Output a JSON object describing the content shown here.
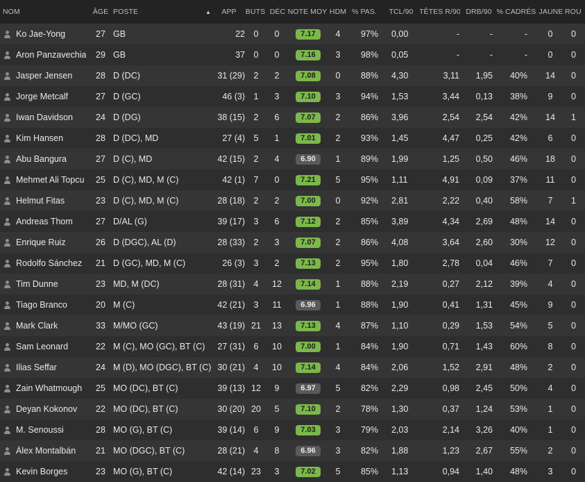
{
  "header": {
    "nom": "NOM",
    "age": "ÂGE",
    "poste": "POSTE",
    "app": "APP",
    "buts": "BUTS",
    "dec": "DÉC",
    "note": "NOTE MOY",
    "hdm": "HDM",
    "pas": "% PAS.",
    "tcl": "TCL/90",
    "tetes": "TÊTES R/90",
    "drb": "DRB/90",
    "cadres": "% CADRÉS",
    "jaune": "JAUNE",
    "rouge": "ROU"
  },
  "sort_indicator": "▲",
  "colors": {
    "good_rating": "#7bb84a",
    "neutral_rating": "#5a5a5a"
  },
  "players": [
    {
      "name": "Ko Jae-Yong",
      "age": "27",
      "pos": "GB",
      "app": "22",
      "buts": "0",
      "dec": "0",
      "note": "7.17",
      "good": true,
      "hdm": "4",
      "pas": "97%",
      "tcl": "0,00",
      "tetes": "-",
      "drb": "-",
      "cadres": "-",
      "jaune": "0",
      "rouge": "0"
    },
    {
      "name": "Aron Panzavechia",
      "age": "29",
      "pos": "GB",
      "app": "37",
      "buts": "0",
      "dec": "0",
      "note": "7.16",
      "good": true,
      "hdm": "3",
      "pas": "98%",
      "tcl": "0,05",
      "tetes": "-",
      "drb": "-",
      "cadres": "-",
      "jaune": "0",
      "rouge": "0"
    },
    {
      "name": "Jasper Jensen",
      "age": "28",
      "pos": "D (DC)",
      "app": "31 (29)",
      "buts": "2",
      "dec": "2",
      "note": "7.08",
      "good": true,
      "hdm": "0",
      "pas": "88%",
      "tcl": "4,30",
      "tetes": "3,11",
      "drb": "1,95",
      "cadres": "40%",
      "jaune": "14",
      "rouge": "0"
    },
    {
      "name": "Jorge Metcalf",
      "age": "27",
      "pos": "D (GC)",
      "app": "46 (3)",
      "buts": "1",
      "dec": "3",
      "note": "7.10",
      "good": true,
      "hdm": "3",
      "pas": "94%",
      "tcl": "1,53",
      "tetes": "3,44",
      "drb": "0,13",
      "cadres": "38%",
      "jaune": "9",
      "rouge": "0"
    },
    {
      "name": "Iwan Davidson",
      "age": "24",
      "pos": "D (DG)",
      "app": "38 (15)",
      "buts": "2",
      "dec": "6",
      "note": "7.07",
      "good": true,
      "hdm": "2",
      "pas": "86%",
      "tcl": "3,96",
      "tetes": "2,54",
      "drb": "2,54",
      "cadres": "42%",
      "jaune": "14",
      "rouge": "1"
    },
    {
      "name": "Kim Hansen",
      "age": "28",
      "pos": "D (DC), MD",
      "app": "27 (4)",
      "buts": "5",
      "dec": "1",
      "note": "7.01",
      "good": true,
      "hdm": "2",
      "pas": "93%",
      "tcl": "1,45",
      "tetes": "4,47",
      "drb": "0,25",
      "cadres": "42%",
      "jaune": "6",
      "rouge": "0"
    },
    {
      "name": "Abu Bangura",
      "age": "27",
      "pos": "D (C), MD",
      "app": "42 (15)",
      "buts": "2",
      "dec": "4",
      "note": "6.90",
      "good": false,
      "hdm": "1",
      "pas": "89%",
      "tcl": "1,99",
      "tetes": "1,25",
      "drb": "0,50",
      "cadres": "46%",
      "jaune": "18",
      "rouge": "0"
    },
    {
      "name": "Mehmet Ali Topcu",
      "age": "25",
      "pos": "D (C), MD, M (C)",
      "app": "42 (1)",
      "buts": "7",
      "dec": "0",
      "note": "7.21",
      "good": true,
      "hdm": "5",
      "pas": "95%",
      "tcl": "1,11",
      "tetes": "4,91",
      "drb": "0,09",
      "cadres": "37%",
      "jaune": "11",
      "rouge": "0"
    },
    {
      "name": "Helmut Fitas",
      "age": "23",
      "pos": "D (C), MD, M (C)",
      "app": "28 (18)",
      "buts": "2",
      "dec": "2",
      "note": "7.00",
      "good": true,
      "hdm": "0",
      "pas": "92%",
      "tcl": "2,81",
      "tetes": "2,22",
      "drb": "0,40",
      "cadres": "58%",
      "jaune": "7",
      "rouge": "1"
    },
    {
      "name": "Andreas Thom",
      "age": "27",
      "pos": "D/AL (G)",
      "app": "39 (17)",
      "buts": "3",
      "dec": "6",
      "note": "7.12",
      "good": true,
      "hdm": "2",
      "pas": "85%",
      "tcl": "3,89",
      "tetes": "4,34",
      "drb": "2,69",
      "cadres": "48%",
      "jaune": "14",
      "rouge": "0"
    },
    {
      "name": "Enrique Ruiz",
      "age": "26",
      "pos": "D (DGC), AL (D)",
      "app": "28 (33)",
      "buts": "2",
      "dec": "3",
      "note": "7.07",
      "good": true,
      "hdm": "2",
      "pas": "86%",
      "tcl": "4,08",
      "tetes": "3,64",
      "drb": "2,60",
      "cadres": "30%",
      "jaune": "12",
      "rouge": "0"
    },
    {
      "name": "Rodolfo Sánchez",
      "age": "21",
      "pos": "D (GC), MD, M (C)",
      "app": "26 (3)",
      "buts": "3",
      "dec": "2",
      "note": "7.13",
      "good": true,
      "hdm": "2",
      "pas": "95%",
      "tcl": "1,80",
      "tetes": "2,78",
      "drb": "0,04",
      "cadres": "46%",
      "jaune": "7",
      "rouge": "0"
    },
    {
      "name": "Tim Dunne",
      "age": "23",
      "pos": "MD, M (DC)",
      "app": "28 (31)",
      "buts": "4",
      "dec": "12",
      "note": "7.14",
      "good": true,
      "hdm": "1",
      "pas": "88%",
      "tcl": "2,19",
      "tetes": "0,27",
      "drb": "2,12",
      "cadres": "39%",
      "jaune": "4",
      "rouge": "0"
    },
    {
      "name": "Tiago Branco",
      "age": "20",
      "pos": "M (C)",
      "app": "42 (21)",
      "buts": "3",
      "dec": "11",
      "note": "6.96",
      "good": false,
      "hdm": "1",
      "pas": "88%",
      "tcl": "1,90",
      "tetes": "0,41",
      "drb": "1,31",
      "cadres": "45%",
      "jaune": "9",
      "rouge": "0"
    },
    {
      "name": "Mark Clark",
      "age": "33",
      "pos": "M/MO (GC)",
      "app": "43 (19)",
      "buts": "21",
      "dec": "13",
      "note": "7.13",
      "good": true,
      "hdm": "4",
      "pas": "87%",
      "tcl": "1,10",
      "tetes": "0,29",
      "drb": "1,53",
      "cadres": "54%",
      "jaune": "5",
      "rouge": "0"
    },
    {
      "name": "Sam Leonard",
      "age": "22",
      "pos": "M (C), MO (GC), BT (C)",
      "app": "27 (31)",
      "buts": "6",
      "dec": "10",
      "note": "7.00",
      "good": true,
      "hdm": "1",
      "pas": "84%",
      "tcl": "1,90",
      "tetes": "0,71",
      "drb": "1,43",
      "cadres": "60%",
      "jaune": "8",
      "rouge": "0"
    },
    {
      "name": "Ilias Seffar",
      "age": "24",
      "pos": "M (D), MO (DGC), BT (C)",
      "app": "30 (21)",
      "buts": "4",
      "dec": "10",
      "note": "7.14",
      "good": true,
      "hdm": "4",
      "pas": "84%",
      "tcl": "2,06",
      "tetes": "1,52",
      "drb": "2,91",
      "cadres": "48%",
      "jaune": "2",
      "rouge": "0"
    },
    {
      "name": "Zain Whatmough",
      "age": "25",
      "pos": "MO (DC), BT (C)",
      "app": "39 (13)",
      "buts": "12",
      "dec": "9",
      "note": "6.97",
      "good": false,
      "hdm": "5",
      "pas": "82%",
      "tcl": "2,29",
      "tetes": "0,98",
      "drb": "2,45",
      "cadres": "50%",
      "jaune": "4",
      "rouge": "0"
    },
    {
      "name": "Deyan Kokonov",
      "age": "22",
      "pos": "MO (DC), BT (C)",
      "app": "30 (20)",
      "buts": "20",
      "dec": "5",
      "note": "7.10",
      "good": true,
      "hdm": "2",
      "pas": "78%",
      "tcl": "1,30",
      "tetes": "0,37",
      "drb": "1,24",
      "cadres": "53%",
      "jaune": "1",
      "rouge": "0"
    },
    {
      "name": "M. Senoussi",
      "age": "28",
      "pos": "MO (G), BT (C)",
      "app": "39 (14)",
      "buts": "6",
      "dec": "9",
      "note": "7.03",
      "good": true,
      "hdm": "3",
      "pas": "79%",
      "tcl": "2,03",
      "tetes": "2,14",
      "drb": "3,26",
      "cadres": "40%",
      "jaune": "1",
      "rouge": "0"
    },
    {
      "name": "Álex Montalbán",
      "age": "21",
      "pos": "MO (DGC), BT (C)",
      "app": "28 (21)",
      "buts": "4",
      "dec": "8",
      "note": "6.96",
      "good": false,
      "hdm": "3",
      "pas": "82%",
      "tcl": "1,88",
      "tetes": "1,23",
      "drb": "2,67",
      "cadres": "55%",
      "jaune": "2",
      "rouge": "0"
    },
    {
      "name": "Kevin Borges",
      "age": "23",
      "pos": "MO (G), BT (C)",
      "app": "42 (14)",
      "buts": "23",
      "dec": "3",
      "note": "7.02",
      "good": true,
      "hdm": "5",
      "pas": "85%",
      "tcl": "1,13",
      "tetes": "0,94",
      "drb": "1,40",
      "cadres": "48%",
      "jaune": "3",
      "rouge": "0"
    }
  ]
}
